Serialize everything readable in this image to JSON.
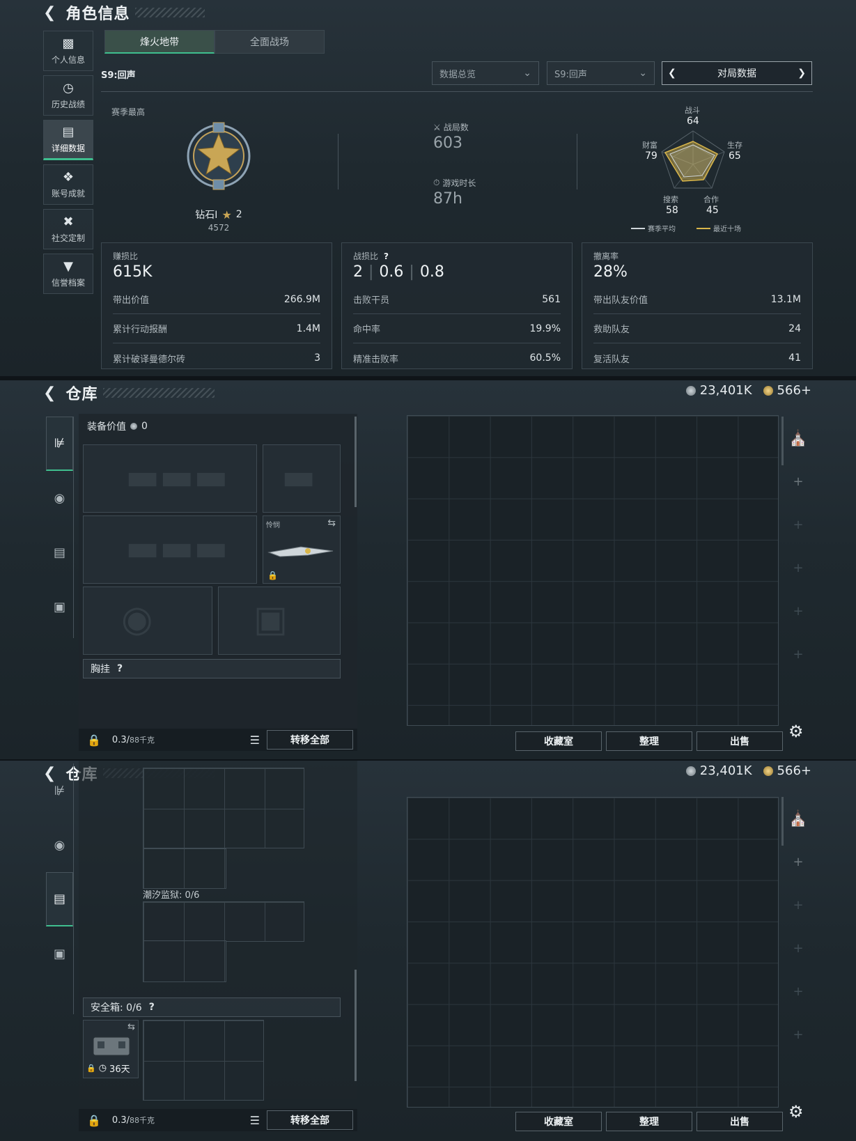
{
  "section1": {
    "title": "角色信息",
    "sidebar": [
      {
        "label": "个人信息",
        "icon": "bar-chart-icon"
      },
      {
        "label": "历史战绩",
        "icon": "clock-icon"
      },
      {
        "label": "详细数据",
        "icon": "folder-icon"
      },
      {
        "label": "账号成就",
        "icon": "achievement-icon"
      },
      {
        "label": "社交定制",
        "icon": "tools-icon"
      },
      {
        "label": "信誉档案",
        "icon": "shield-icon"
      }
    ],
    "tabs": [
      "烽火地带",
      "全面战场"
    ],
    "season_label": "S9:回声",
    "dropdown_overview": "数据总览",
    "dropdown_season": "S9:回声",
    "pager_label": "对局数据",
    "season_best_label": "赛季最高",
    "rank_name": "钻石I",
    "rank_stars": "2",
    "rank_score": "4572",
    "matches_label": "战局数",
    "matches_value": "603",
    "playtime_label": "游戏时长",
    "playtime_value": "87h",
    "radar": {
      "top_label": "战斗",
      "top_value": "64",
      "right_label": "生存",
      "right_value": "65",
      "left_label": "财富",
      "left_value": "79",
      "bl_label": "搜索",
      "bl_value": "58",
      "br_label": "合作",
      "br_value": "45",
      "legend_season": "赛季平均",
      "legend_recent": "最近十场",
      "season_color": "#cfd6da",
      "recent_color": "#d9b64a"
    },
    "box1": {
      "title": "赚损比",
      "big": "615K",
      "rows": [
        [
          "带出价值",
          "266.9M"
        ],
        [
          "累计行动报酬",
          "1.4M"
        ],
        [
          "累计破译曼德尔砖",
          "3"
        ]
      ]
    },
    "box2": {
      "title": "战损比",
      "help": "?",
      "big_a": "2",
      "big_b": "0.6",
      "big_c": "0.8",
      "rows": [
        [
          "击败干员",
          "561"
        ],
        [
          "命中率",
          "19.9%"
        ],
        [
          "精准击败率",
          "60.5%"
        ]
      ]
    },
    "box3": {
      "title": "撤离率",
      "big": "28%",
      "rows": [
        [
          "带出队友价值",
          "13.1M"
        ],
        [
          "救助队友",
          "24"
        ],
        [
          "复活队友",
          "41"
        ]
      ]
    }
  },
  "warehouse": {
    "title": "仓库",
    "silver": "23,401K",
    "gold": "566+",
    "equip_value_label": "装备价值",
    "equip_value": "0",
    "melee_label": "怜悯",
    "chest_rig_label": "胸挂",
    "help": "?",
    "weight": "0.3/",
    "weight_cap": "88千克",
    "transfer_all": "转移全部",
    "collection": "收藏室",
    "sort": "整理",
    "sell": "出售",
    "tidal_label": "潮汐监狱: 0/6",
    "safebox_label": "安全箱: 0/6",
    "safebox_days": "36天"
  }
}
